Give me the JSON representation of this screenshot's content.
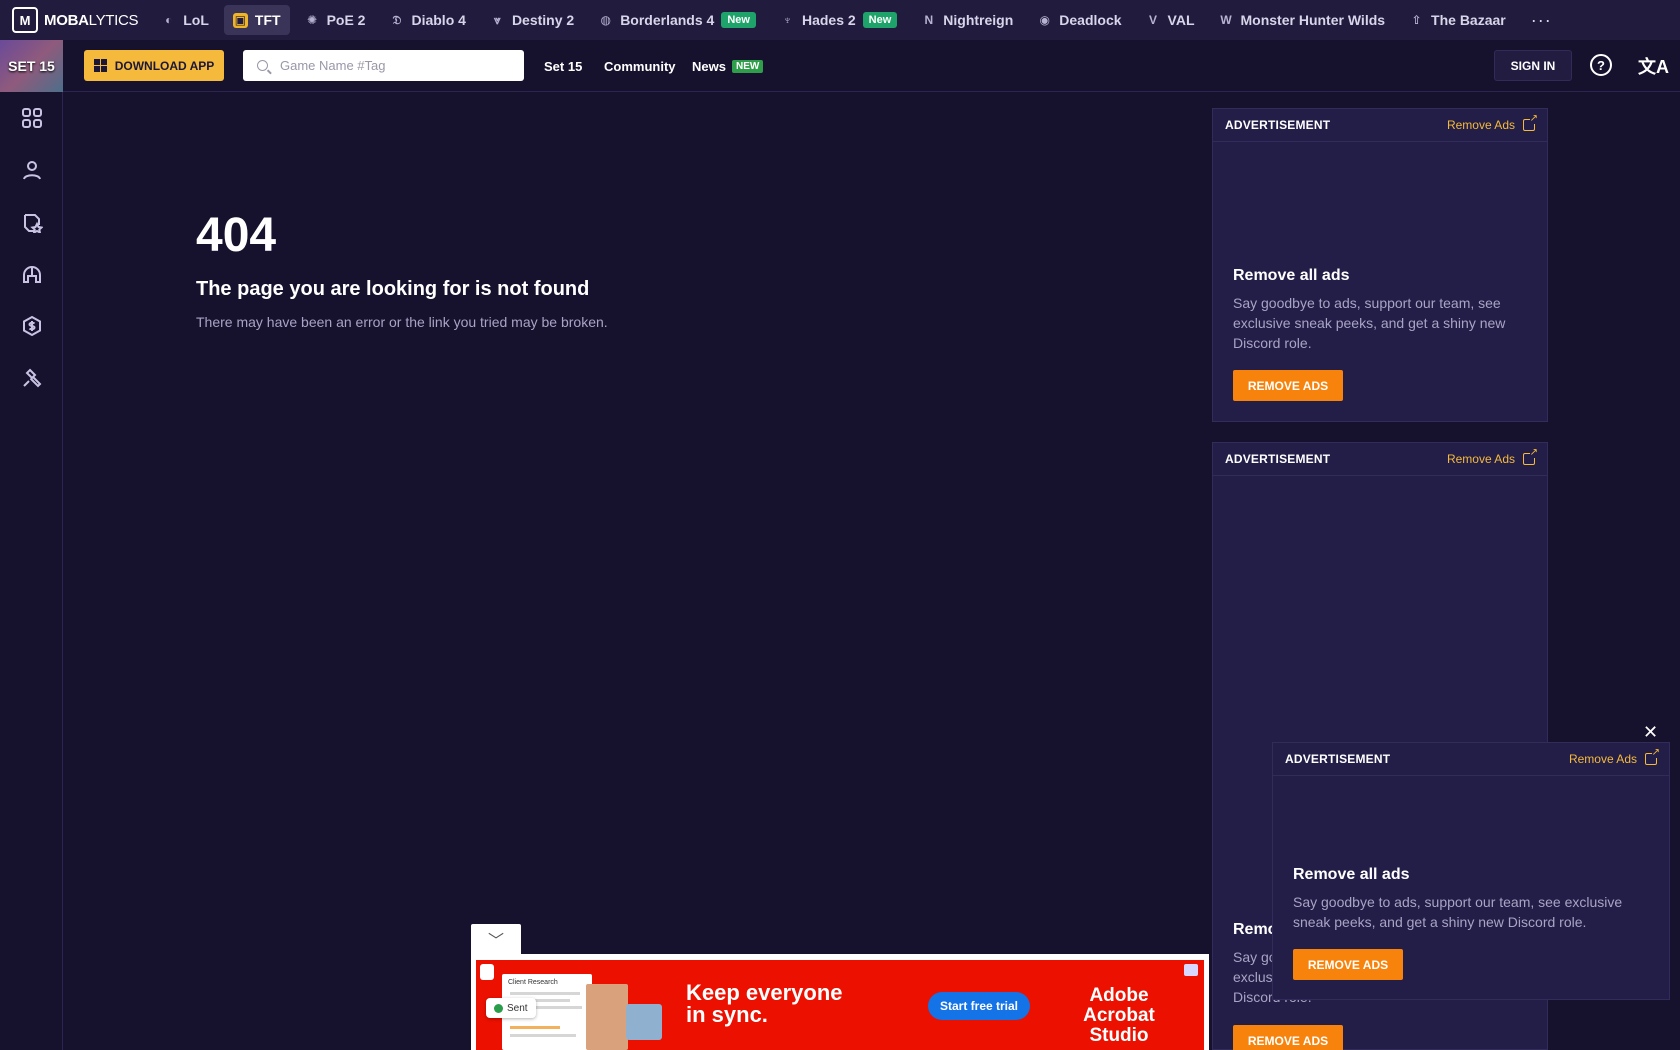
{
  "brand": {
    "logo_text_bold": "MOBA",
    "logo_text_thin": "LYTICS"
  },
  "games": [
    {
      "label": "LoL",
      "icon": "lol-icon",
      "active": false
    },
    {
      "label": "TFT",
      "icon": "tft-icon",
      "active": true
    },
    {
      "label": "PoE 2",
      "icon": "poe2-icon",
      "active": false
    },
    {
      "label": "Diablo 4",
      "icon": "diablo-icon",
      "active": false
    },
    {
      "label": "Destiny 2",
      "icon": "destiny-icon",
      "active": false
    },
    {
      "label": "Borderlands 4",
      "icon": "borderlands-icon",
      "active": false,
      "badge": "New"
    },
    {
      "label": "Hades 2",
      "icon": "hades-icon",
      "active": false,
      "badge": "New"
    },
    {
      "label": "Nightreign",
      "icon": "nightreign-icon",
      "active": false
    },
    {
      "label": "Deadlock",
      "icon": "deadlock-icon",
      "active": false
    },
    {
      "label": "VAL",
      "icon": "valorant-icon",
      "active": false
    },
    {
      "label": "Monster Hunter Wilds",
      "icon": "mhw-icon",
      "active": false
    },
    {
      "label": "The Bazaar",
      "icon": "bazaar-icon",
      "active": false
    }
  ],
  "header": {
    "set_badge": "SET 15",
    "download_label": "DOWNLOAD APP",
    "search_placeholder": "Game Name #Tag",
    "nav_set": "Set 15",
    "nav_community": "Community",
    "nav_news": "News",
    "nav_news_badge": "NEW",
    "signin_label": "SIGN IN"
  },
  "error": {
    "code": "404",
    "title": "The page you are looking for is not found",
    "description": "There may have been an error or the link you tried may be broken."
  },
  "ads": {
    "label": "ADVERTISEMENT",
    "remove_link": "Remove Ads",
    "promo_title": "Remove all ads",
    "promo_text": "Say goodbye to ads, support our team, see exclusive sneak peeks, and get a shiny new Discord role.",
    "promo_button": "REMOVE ADS",
    "partial_title": "Remo",
    "partial_text_1": "Say go",
    "partial_text_2": "exclus",
    "partial_text_3": "Discord role."
  },
  "banner": {
    "doc_title": "Client Research",
    "sent_label": "Sent",
    "headline": "Keep everyone in sync.",
    "cta": "Start free trial",
    "brand_line1": "Adobe",
    "brand_line2": "Acrobat Studio"
  },
  "colors": {
    "accent": "#f5b93c",
    "remove_button": "#f7820c",
    "background": "#16122e",
    "new_badge": "#1ea46a"
  }
}
